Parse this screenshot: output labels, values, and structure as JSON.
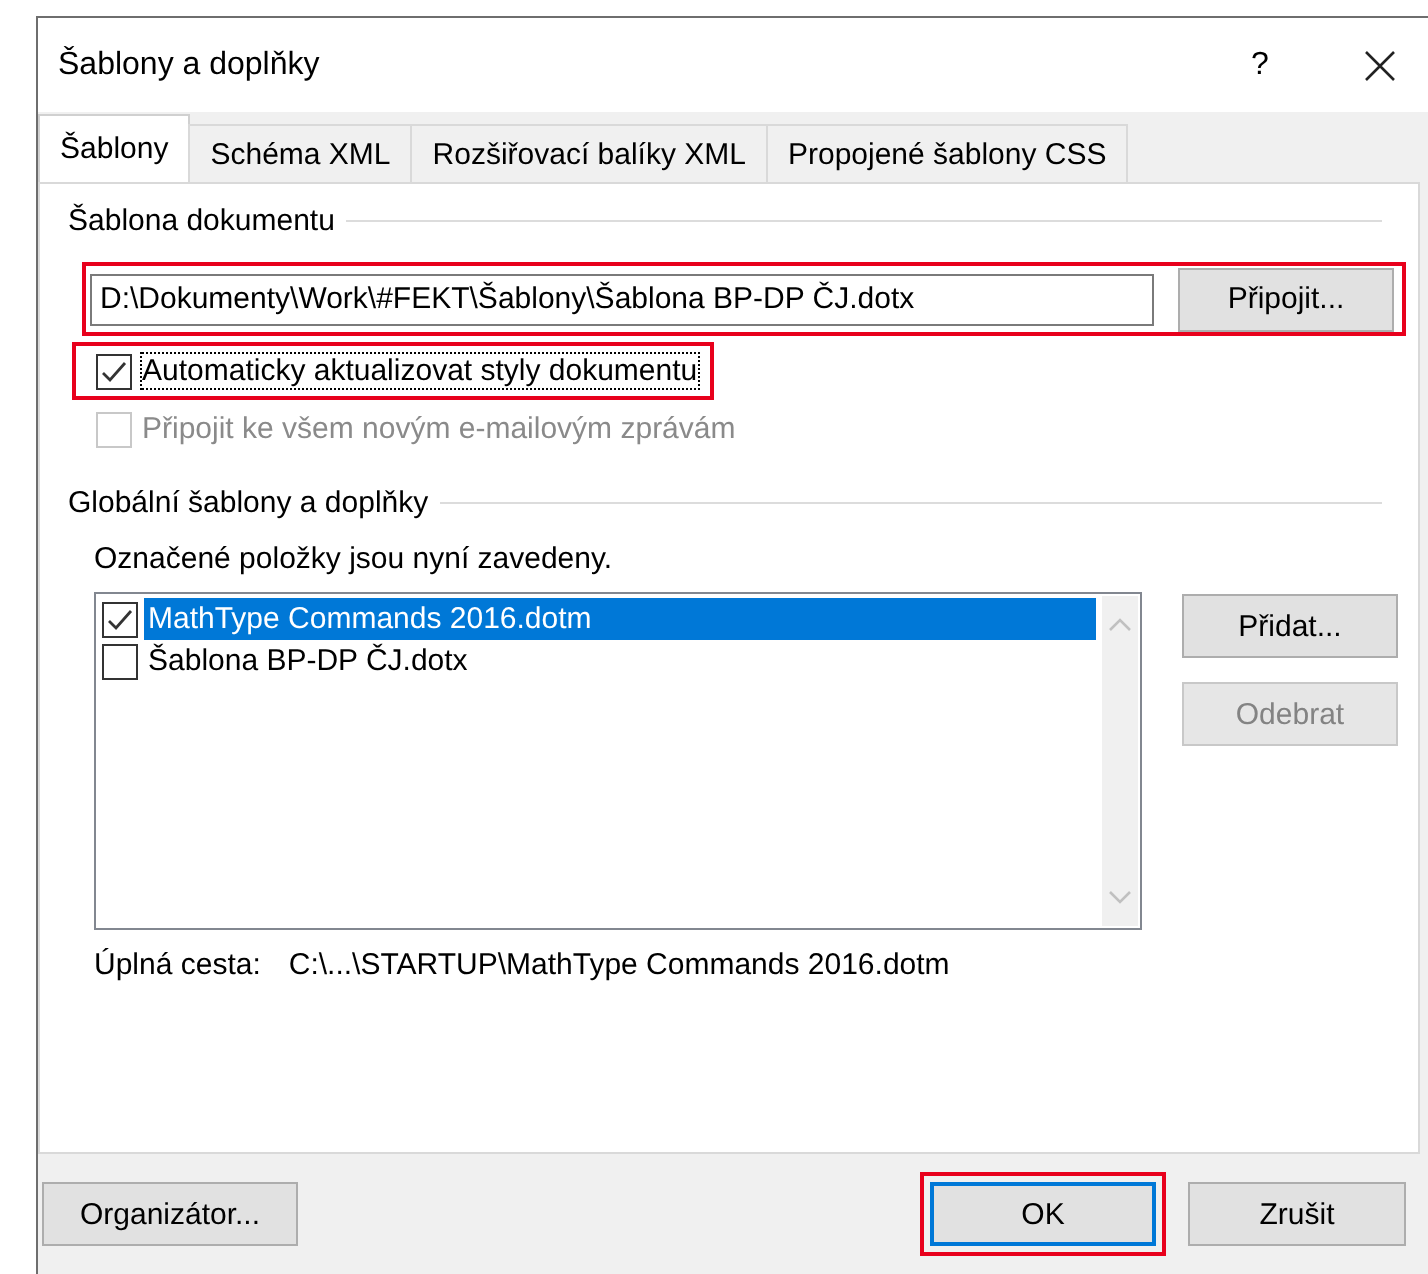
{
  "window": {
    "title": "Šablony a doplňky",
    "help_glyph": "?"
  },
  "tabs": [
    {
      "label": "Šablony",
      "selected": true
    },
    {
      "label": "Schéma XML",
      "selected": false
    },
    {
      "label": "Rozšiřovací balíky XML",
      "selected": false
    },
    {
      "label": "Propojené šablony CSS",
      "selected": false
    }
  ],
  "document_template": {
    "heading": "Šablona dokumentu",
    "path": "D:\\Dokumenty\\Work\\#FEKT\\Šablony\\Šablona BP-DP ČJ.dotx",
    "attach_button": "Připojit...",
    "highlighted": true
  },
  "options": [
    {
      "label": "Automaticky aktualizovat styly dokumentu",
      "checked": true,
      "disabled": false,
      "highlighted": true
    },
    {
      "label": "Připojit ke všem novým e-mailovým zprávám",
      "checked": false,
      "disabled": true,
      "highlighted": false
    }
  ],
  "global": {
    "heading": "Globální šablony a doplňky",
    "caption": "Označené položky jsou nyní zavedeny.",
    "items": [
      {
        "label": "MathType Commands 2016.dotm",
        "checked": true,
        "selected": true
      },
      {
        "label": "Šablona BP-DP ČJ.dotx",
        "checked": false,
        "selected": false
      }
    ],
    "buttons": [
      {
        "label": "Přidat...",
        "disabled": false
      },
      {
        "label": "Odebrat",
        "disabled": true
      }
    ],
    "path_label": "Úplná cesta:",
    "path_value": "C:\\...\\STARTUP\\MathType Commands 2016.dotm"
  },
  "footer_buttons": [
    {
      "label": "Organizátor...",
      "default": false,
      "highlighted": false
    },
    {
      "label": "OK",
      "default": true,
      "highlighted": true
    },
    {
      "label": "Zrušit",
      "default": false,
      "highlighted": false
    }
  ]
}
